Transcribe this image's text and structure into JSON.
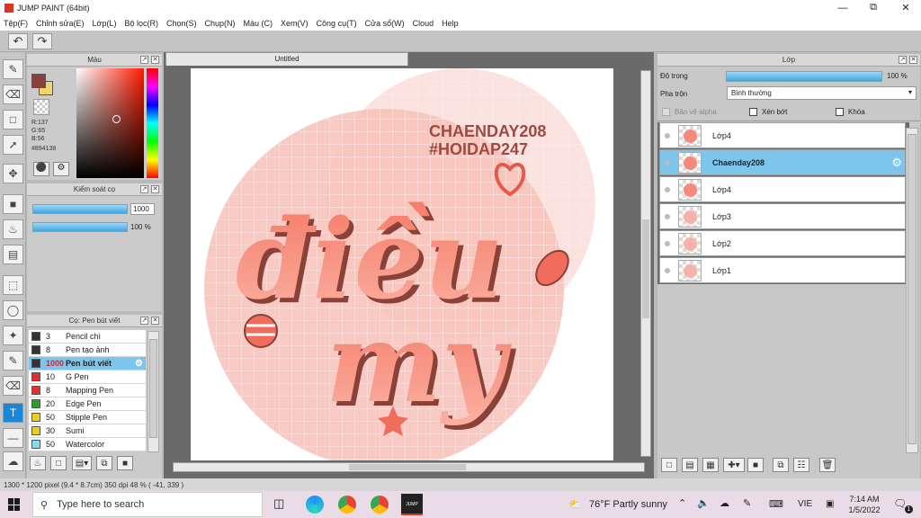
{
  "window": {
    "title": "JUMP PAINT (64bit)"
  },
  "menu": [
    "Tệp(F)",
    "Chỉnh sửa(E)",
    "Lớp(L)",
    "Bộ lọc(R)",
    "Chọn(S)",
    "Chụp(N)",
    "Màu (C)",
    "Xem(V)",
    "Công cụ(T)",
    "Cửa sổ(W)",
    "Cloud",
    "Help"
  ],
  "color_panel": {
    "title": "Màu",
    "r": "R:137",
    "g": "G:65",
    "b": "B:56",
    "hex": "#894138",
    "fg_color": "#894138",
    "bg_color": "#f3d56b"
  },
  "brush_control": {
    "title": "Kiểm soát cọ",
    "size_value": "1000",
    "opacity_value": "100 %",
    "size_fraction": 1.0,
    "opacity_fraction": 1.0
  },
  "brush_list": {
    "title": "Cọ: Pen bút viết",
    "items": [
      {
        "size": "3",
        "name": "Pencil chì",
        "color": "#333333"
      },
      {
        "size": "8",
        "name": "Pen tạo ảnh",
        "color": "#333333"
      },
      {
        "size": "1000",
        "name": "Pen bút viết",
        "color": "#333333",
        "selected": true
      },
      {
        "size": "10",
        "name": "G Pen",
        "color": "#e03030"
      },
      {
        "size": "8",
        "name": "Mapping Pen",
        "color": "#e03030"
      },
      {
        "size": "20",
        "name": "Edge Pen",
        "color": "#2aa02a"
      },
      {
        "size": "50",
        "name": "Stipple Pen",
        "color": "#e8d020"
      },
      {
        "size": "30",
        "name": "Sumi",
        "color": "#e8d020"
      },
      {
        "size": "50",
        "name": "Watercolor",
        "color": "#88d8f0"
      }
    ]
  },
  "canvas": {
    "tab": "Untitled",
    "art_handles": [
      "CHAENDAY208",
      "#HOIDAP247"
    ],
    "art_title": [
      "điều",
      "my"
    ]
  },
  "layer_panel": {
    "title": "Lớp",
    "opacity_label": "Độ trong",
    "opacity_value": "100 %",
    "opacity_fraction": 1.0,
    "blend_label": "Pha trộn",
    "blend_value": "Bình thường",
    "protect_alpha": "Bảo vệ alpha",
    "clip": "Xén bớt",
    "lock": "Khóa",
    "layers": [
      {
        "name": "Lớp4",
        "selected": false
      },
      {
        "name": "Chaenday208",
        "selected": true
      },
      {
        "name": "Lớp4",
        "selected": false
      },
      {
        "name": "Lớp3",
        "selected": false
      },
      {
        "name": "Lớp2",
        "selected": false
      },
      {
        "name": "Lớp1",
        "selected": false
      }
    ]
  },
  "status": {
    "text": "1300 * 1200 pixel  (9.4 * 8.7cm)  350 dpi  48 %  ( -41, 339 )"
  },
  "taskbar": {
    "search_placeholder": "Type here to search",
    "weather": "76°F  Partly sunny",
    "lang": "VIE",
    "time": "7:14 AM",
    "date": "1/5/2022",
    "notif_count": "1"
  },
  "colors": {
    "accent": "#1b86d6",
    "selected_row": "#7cc6ee",
    "art_pink": "#f6b3aa",
    "art_coral": "#f06c5c",
    "art_dark": "#894138"
  }
}
